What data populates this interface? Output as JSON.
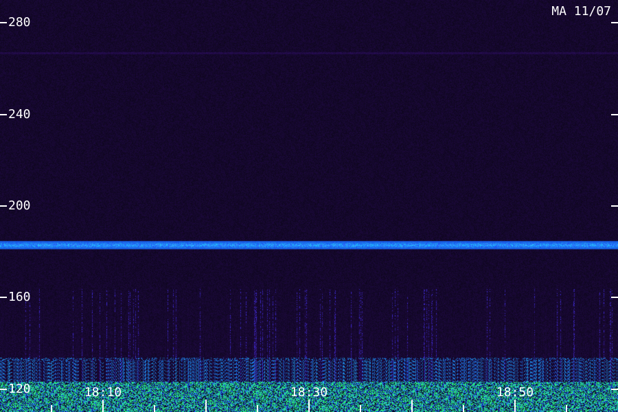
{
  "corner_label": "MA 11/07",
  "y_axis": {
    "range": [
      110,
      290
    ],
    "ticks": [
      {
        "value": 280,
        "label": "280"
      },
      {
        "value": 240,
        "label": "240"
      },
      {
        "value": 200,
        "label": "200"
      },
      {
        "value": 160,
        "label": "160"
      },
      {
        "value": 120,
        "label": "120"
      }
    ]
  },
  "x_axis": {
    "labels": [
      "18:10",
      "18:30",
      "18:50"
    ]
  },
  "colors": {
    "background": "#1a0630",
    "band": "#2f7bff",
    "low_band": "#3cff5a",
    "text": "#ffffff"
  }
}
